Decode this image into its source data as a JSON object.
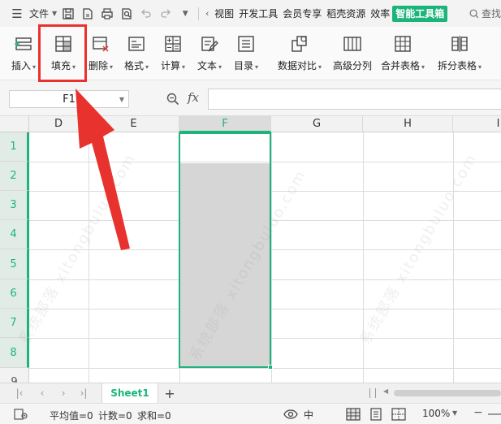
{
  "menubar": {
    "file_label": "文件",
    "tabs": [
      {
        "label": "视图"
      },
      {
        "label": "开发工具"
      },
      {
        "label": "会员专享"
      },
      {
        "label": "稻壳资源"
      },
      {
        "label": "效率"
      },
      {
        "label": "智能工具箱",
        "active": true
      }
    ],
    "search_label": "查找"
  },
  "toolbar": {
    "buttons": [
      {
        "label": "插入",
        "icon": "insert-icon"
      },
      {
        "label": "填充",
        "icon": "fill-icon"
      },
      {
        "label": "删除",
        "icon": "delete-icon"
      },
      {
        "label": "格式",
        "icon": "format-icon"
      },
      {
        "label": "计算",
        "icon": "calculate-icon"
      },
      {
        "label": "文本",
        "icon": "text-icon"
      },
      {
        "label": "目录",
        "icon": "catalog-icon"
      },
      {
        "label": "数据对比",
        "icon": "data-compare-icon"
      },
      {
        "label": "高级分列",
        "icon": "advanced-split-icon"
      },
      {
        "label": "合并表格",
        "icon": "merge-table-icon"
      },
      {
        "label": "拆分表格",
        "icon": "split-table-icon"
      }
    ]
  },
  "formulabar": {
    "cell_ref": "F1",
    "fx_label": "fx",
    "formula": ""
  },
  "grid": {
    "columns": [
      {
        "label": "D"
      },
      {
        "label": "E"
      },
      {
        "label": "F",
        "selected": true
      },
      {
        "label": "G"
      },
      {
        "label": "H"
      },
      {
        "label": "I"
      }
    ],
    "rows": [
      {
        "label": "1"
      },
      {
        "label": "2"
      },
      {
        "label": "3"
      },
      {
        "label": "4"
      },
      {
        "label": "5"
      },
      {
        "label": "6"
      },
      {
        "label": "7"
      },
      {
        "label": "8"
      },
      {
        "label": "9"
      }
    ],
    "selection": "F1:F8",
    "watermark": "系统部落 xitongbuluo.com"
  },
  "sheets": {
    "tabs": [
      {
        "label": "Sheet1",
        "active": true
      }
    ],
    "add_label": "+"
  },
  "statusbar": {
    "average": "平均值=0",
    "count": "计数=0",
    "sum": "求和=0",
    "zoom": "100%"
  },
  "colors": {
    "accent": "#1bb47a",
    "annotation": "#e8322d",
    "selection_fill": "#d6d6d6"
  }
}
